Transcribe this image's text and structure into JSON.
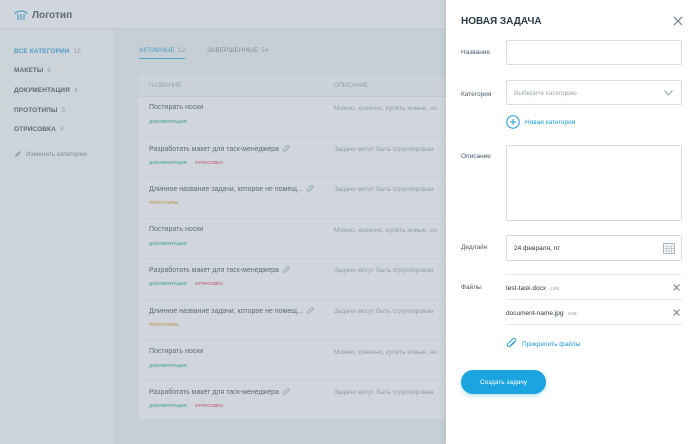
{
  "app": {
    "logo_text": "Логотип"
  },
  "sidebar": {
    "categories": [
      {
        "label": "ВСЕ КАТЕГОРИИ",
        "count": "12"
      },
      {
        "label": "МАКЕТЫ",
        "count": "6"
      },
      {
        "label": "ДОКУМЕНТАЦИЯ",
        "count": "4"
      },
      {
        "label": "ПРОТОТИПЫ",
        "count": "3"
      },
      {
        "label": "ОТРИСОВКА",
        "count": "4"
      }
    ],
    "edit_label": "Изменить категории"
  },
  "tabs": [
    {
      "label": "АКТИВНЫЕ",
      "count": "12"
    },
    {
      "label": "ЗАВЕРШЕННЫЕ",
      "count": "54"
    }
  ],
  "table": {
    "headers": [
      "НАЗВАНИЕ",
      "ОПИСАНИЕ"
    ],
    "rows": [
      {
        "title": "Постирать носки",
        "desc": "Можно, конечно, купить новые, но",
        "tags": [
          "ДОКУМЕНТАЦИЯ"
        ],
        "clip": false
      },
      {
        "title": "Разработать макет для таск-менеджера",
        "desc": "Задачи могут быть сгруппирован",
        "tags": [
          "ДОКУМЕНТАЦИЯ",
          "ОТРИСОВКА"
        ],
        "clip": true
      },
      {
        "title": "Длинное название задачи, которое не помещ...",
        "desc": "Задачи могут быть сгруппирован",
        "tags": [
          "ПРОТОТИПЫ"
        ],
        "clip": true
      },
      {
        "title": "Постирать носки",
        "desc": "Можно, конечно, купить новые, но",
        "tags": [
          "ДОКУМЕНТАЦИЯ"
        ],
        "clip": false
      },
      {
        "title": "Разработать макет для таск-менеджера",
        "desc": "Задачи могут быть сгруппирован",
        "tags": [
          "ДОКУМЕНТАЦИЯ",
          "ОТРИСОВКА"
        ],
        "clip": true
      },
      {
        "title": "Длинное название задачи, которое не помещ...",
        "desc": "Задачи могут быть сгруппирован",
        "tags": [
          "ПРОТОТИПЫ"
        ],
        "clip": true
      },
      {
        "title": "Постирать носки",
        "desc": "Можно, конечно, купить новые, но",
        "tags": [
          "ДОКУМЕНТАЦИЯ"
        ],
        "clip": false
      },
      {
        "title": "Разработать макет для таск-менеджера",
        "desc": "Задачи могут быть сгруппирован",
        "tags": [
          "ДОКУМЕНТАЦИЯ",
          "ОТРИСОВКА"
        ],
        "clip": true
      }
    ]
  },
  "modal": {
    "title": "НОВАЯ ЗАДАЧА",
    "name_label": "Название",
    "name_value": "",
    "category_label": "Категория",
    "category_placeholder": "Выберите категорию",
    "new_category_label": "Новая категория",
    "description_label": "Описание",
    "description_value": "",
    "deadline_label": "Дедлайн",
    "deadline_value": "24 февраля, пт",
    "files_label": "Файлы",
    "files": [
      {
        "name": "test-task.docx",
        "size": "1МБ"
      },
      {
        "name": "document-name.jpg",
        "size": "1МБ"
      }
    ],
    "attach_label": "Прикрепить файлы",
    "create_label": "Создать задачу"
  },
  "colors": {
    "accent": "#1ba5e0",
    "tag_documentation": "#2fae8a",
    "tag_drawing": "#e04b5b",
    "tag_prototypes": "#e09a28"
  }
}
